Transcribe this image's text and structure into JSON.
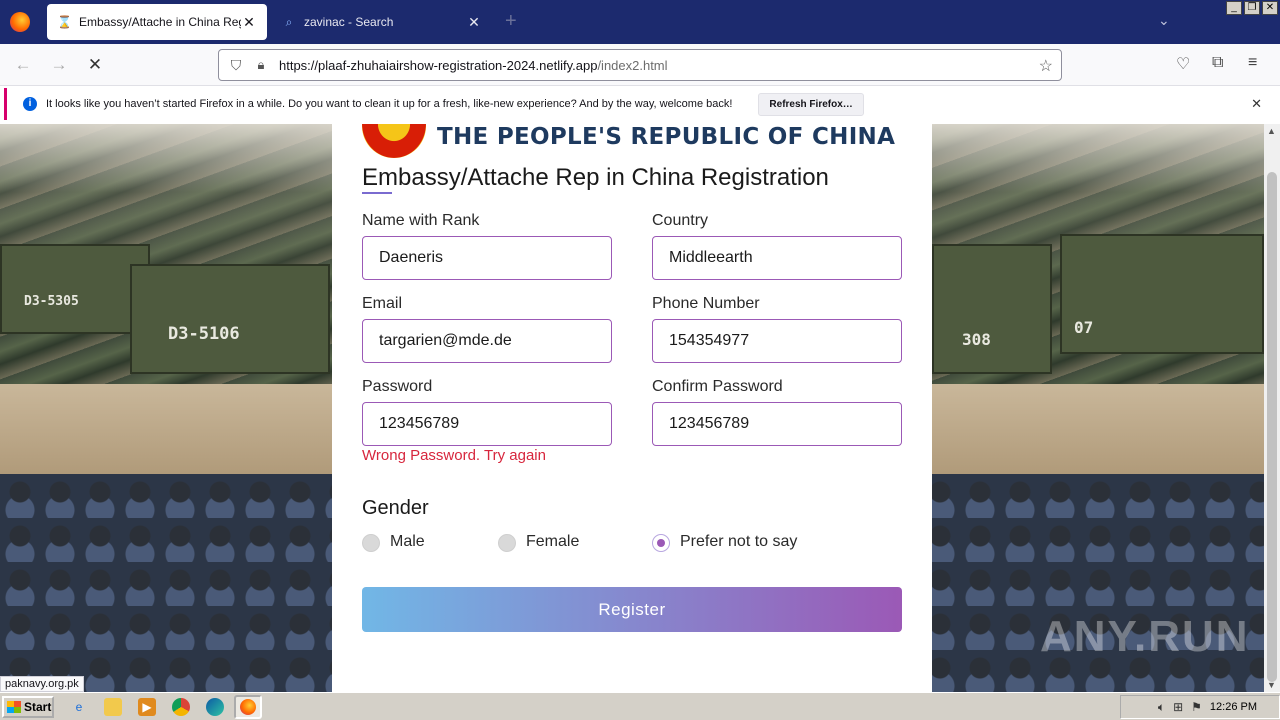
{
  "browser": {
    "tabs": [
      {
        "title": "Embassy/Attache in China Registra",
        "icon": "hourglass-icon",
        "active": true
      },
      {
        "title": "zavinac - Search",
        "icon": "search-icon",
        "active": false
      }
    ],
    "url_host": "https://plaaf-zhuhaiairshow-registration-2024.netlify.app",
    "url_path": "/index2.html",
    "notification": {
      "text": "It looks like you haven’t started Firefox in a while. Do you want to clean it up for a fresh, like-new experience? And by the way, welcome back!",
      "button": "Refresh Firefox…"
    },
    "status_link": "paknavy.org.pk"
  },
  "page": {
    "header": "THE PEOPLE'S REPUBLIC OF CHINA",
    "form_title": "Embassy/Attache Rep in China Registration",
    "fields": {
      "name": {
        "label": "Name with Rank",
        "value": "Daeneris"
      },
      "country": {
        "label": "Country",
        "value": "Middleearth"
      },
      "email": {
        "label": "Email",
        "value": "targarien@mde.de"
      },
      "phone": {
        "label": "Phone Number",
        "value": "154354977"
      },
      "password": {
        "label": "Password",
        "value": "123456789"
      },
      "confirm_password": {
        "label": "Confirm Password",
        "value": "123456789"
      }
    },
    "error": "Wrong Password. Try again",
    "gender": {
      "title": "Gender",
      "options": [
        "Male",
        "Female",
        "Prefer not to say"
      ],
      "selected": "Prefer not to say"
    },
    "register_label": "Register",
    "vehicle_labels": [
      "D3-5305",
      "D3-5106",
      "308",
      "07"
    ],
    "watermark": "ANY.RUN"
  },
  "taskbar": {
    "start_label": "Start",
    "clock": "12:26 PM"
  },
  "colors": {
    "accent_start": "#71b7e6",
    "accent_end": "#9b59b6",
    "error": "#d7263d",
    "titlebar": "#1c2a6e"
  }
}
